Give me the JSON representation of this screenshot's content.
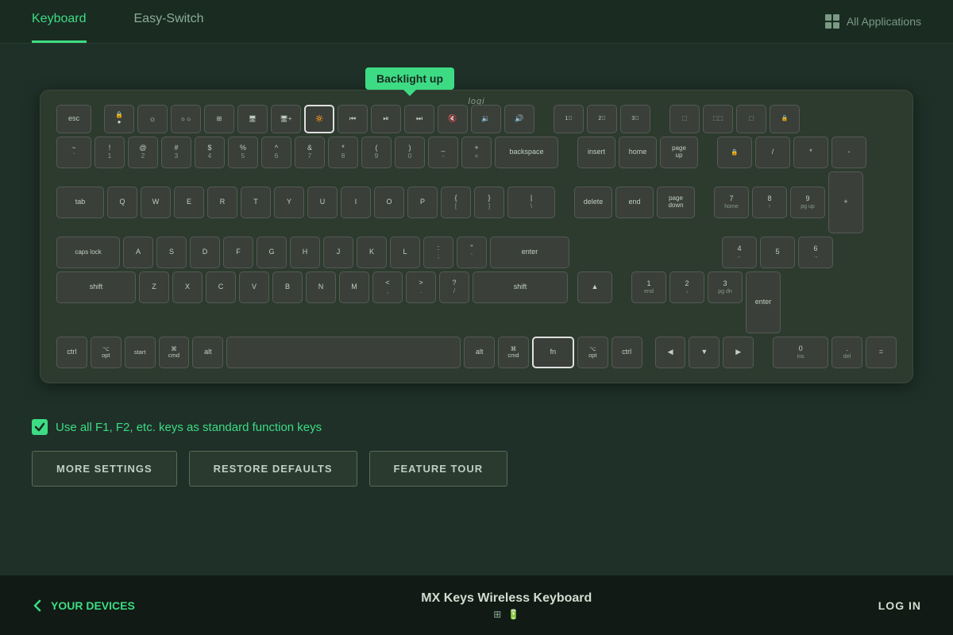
{
  "header": {
    "tab_keyboard": "Keyboard",
    "tab_easyswitch": "Easy-Switch",
    "all_apps_label": "All Applications"
  },
  "tooltip": {
    "text": "Backlight up"
  },
  "logi": "logi",
  "checkbox": {
    "label": "Use all F1, F2, etc. keys as standard function keys"
  },
  "buttons": {
    "more_settings": "MORE SETTINGS",
    "restore_defaults": "RESTORE DEFAULTS",
    "feature_tour": "FEATURE TOUR"
  },
  "footer": {
    "your_devices": "YOUR DEVICES",
    "device_name": "MX Keys Wireless Keyboard",
    "log_in": "LOG IN"
  }
}
